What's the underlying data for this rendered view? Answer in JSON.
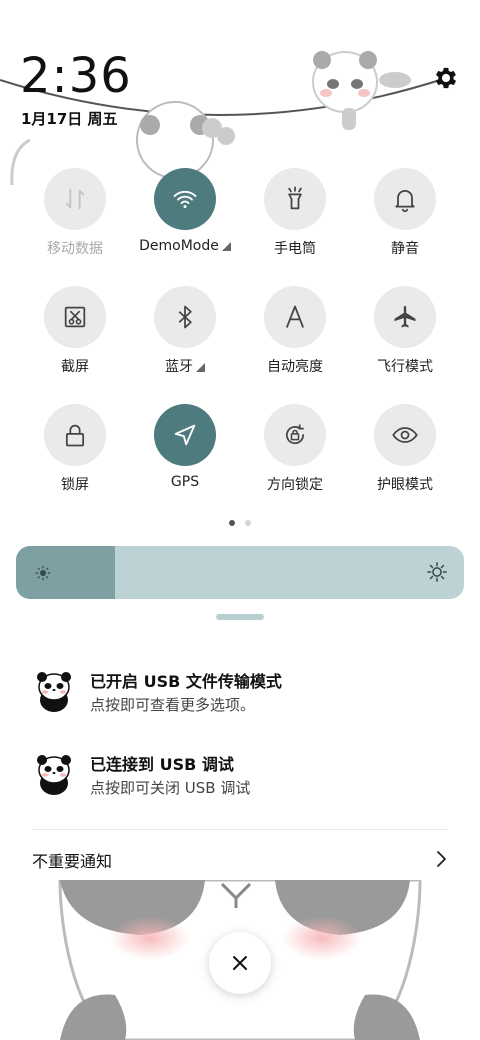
{
  "header": {
    "time": "2:36",
    "date": "1月17日 周五",
    "settings_icon": "gear-icon"
  },
  "toggles": [
    {
      "label": "移动数据",
      "icon": "mobile-data-icon",
      "active": false,
      "disabled": true,
      "has_arrow": false
    },
    {
      "label": "DemoMode",
      "icon": "wifi-icon",
      "active": true,
      "disabled": false,
      "has_arrow": true
    },
    {
      "label": "手电筒",
      "icon": "flashlight-icon",
      "active": false,
      "disabled": false,
      "has_arrow": false
    },
    {
      "label": "静音",
      "icon": "bell-icon",
      "active": false,
      "disabled": false,
      "has_arrow": false
    },
    {
      "label": "截屏",
      "icon": "screenshot-icon",
      "active": false,
      "disabled": false,
      "has_arrow": false
    },
    {
      "label": "蓝牙",
      "icon": "bluetooth-icon",
      "active": false,
      "disabled": false,
      "has_arrow": true
    },
    {
      "label": "自动亮度",
      "icon": "auto-brightness-icon",
      "active": false,
      "disabled": false,
      "has_arrow": false
    },
    {
      "label": "飞行模式",
      "icon": "airplane-icon",
      "active": false,
      "disabled": false,
      "has_arrow": false
    },
    {
      "label": "锁屏",
      "icon": "lock-icon",
      "active": false,
      "disabled": false,
      "has_arrow": false
    },
    {
      "label": "GPS",
      "icon": "location-icon",
      "active": true,
      "disabled": false,
      "has_arrow": false
    },
    {
      "label": "方向锁定",
      "icon": "rotation-lock-icon",
      "active": false,
      "disabled": false,
      "has_arrow": false
    },
    {
      "label": "护眼模式",
      "icon": "eye-icon",
      "active": false,
      "disabled": false,
      "has_arrow": false
    }
  ],
  "pager": {
    "pages": 2,
    "current": 0
  },
  "brightness": {
    "level": 0.22
  },
  "notifications": [
    {
      "title": "已开启 USB 文件传输模式",
      "body": "点按即可查看更多选项。",
      "icon": "panda-app-icon"
    },
    {
      "title": "已连接到 USB 调试",
      "body": "点按即可关闭 USB 调试",
      "icon": "panda-app-icon"
    }
  ],
  "minor_notifications": {
    "label": "不重要通知",
    "icon": "chevron-right-icon"
  },
  "close_button": {
    "icon": "close-icon"
  },
  "colors": {
    "accent": "#4e7b7e",
    "tile_bg": "#e9eaea",
    "slider_track": "#bcd2d5",
    "slider_fill": "#7ea0a3"
  }
}
